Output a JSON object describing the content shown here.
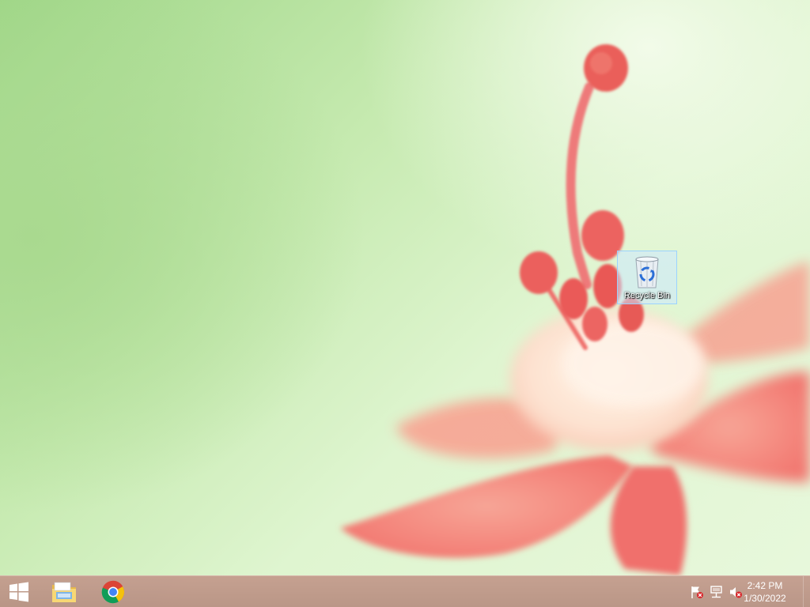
{
  "desktop": {
    "icons": [
      {
        "label": "Recycle Bin",
        "icon": "recycle-bin-icon"
      }
    ]
  },
  "taskbar": {
    "start": {
      "icon": "windows-logo-icon"
    },
    "pinned": [
      {
        "icon": "file-explorer-icon"
      },
      {
        "icon": "chrome-icon"
      }
    ],
    "tray": [
      {
        "icon": "action-center-flag-icon"
      },
      {
        "icon": "network-icon"
      },
      {
        "icon": "volume-muted-icon"
      }
    ],
    "clock": {
      "time": "2:42 PM",
      "date": "1/30/2022"
    }
  },
  "colors": {
    "taskbar": "#bd968a",
    "wallpaper_green": "#c6eab0",
    "flower_pink": "#f47a78"
  }
}
